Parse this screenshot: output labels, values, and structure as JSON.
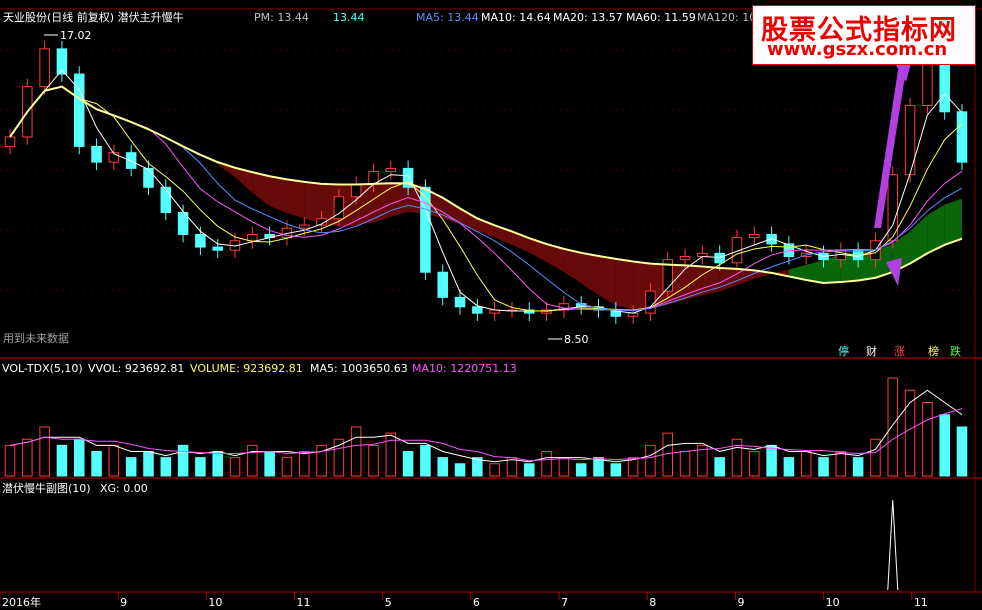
{
  "header": {
    "title": "天业股份(日线 前复权) 潜伏主升慢牛",
    "pm_label": "PM: 13.44",
    "pm_value": "13.44",
    "ma5": "MA5: 13.44",
    "ma10": "MA10: 14.64",
    "ma20": "MA20: 13.57",
    "ma60": "MA60: 11.59",
    "ma120": "MA120: 10"
  },
  "watermark": {
    "line1": "股票公式指标网",
    "line2": "www.gszx.com.cn"
  },
  "main_panel": {
    "high_label": "17.02",
    "low_label": "8.50",
    "future_note": "用到未来数据",
    "buttons": [
      "停",
      "财",
      "涨",
      "榜",
      "跌"
    ]
  },
  "vol_panel": {
    "name": "VOL-TDX(5,10)",
    "vvol": "VVOL: 923692.81",
    "volume": "VOLUME: 923692.81",
    "ma5": "MA5: 1003650.63",
    "ma10": "MA10: 1220751.13"
  },
  "sub_panel": {
    "name": "潜伏慢牛副图(10)",
    "xg": "XG: 0.00"
  },
  "x_axis": [
    "2016年",
    "9",
    "10",
    "11",
    "5",
    "6",
    "7",
    "8",
    "9",
    "10",
    "11"
  ],
  "colors": {
    "up": "#ff3c3c",
    "down": "#54ffff",
    "ma5": "#ffffff",
    "ma10": "#ffff54",
    "ma20": "#ff54ff",
    "ma60": "#5a8cff",
    "ma120": "#ffff9c",
    "band_up": "#0b6b0b",
    "band_down": "#6b0b0b",
    "grid": "#800000"
  },
  "chart_data": {
    "type": "candlestick",
    "close_series": [
      14.2,
      15.8,
      17.0,
      16.2,
      13.9,
      13.4,
      13.7,
      13.2,
      12.6,
      11.8,
      11.1,
      10.7,
      10.6,
      10.9,
      11.1,
      11.0,
      11.3,
      11.4,
      11.6,
      12.3,
      12.7,
      13.1,
      13.2,
      12.6,
      9.9,
      9.1,
      8.8,
      8.6,
      8.7,
      8.7,
      8.6,
      8.7,
      8.9,
      8.8,
      8.7,
      8.5,
      8.6,
      9.3,
      10.3,
      10.4,
      10.5,
      10.2,
      11.0,
      11.1,
      10.8,
      10.4,
      10.5,
      10.3,
      10.6,
      10.3,
      10.9,
      13.0,
      15.2,
      16.5,
      15.0,
      13.4
    ],
    "volume_series": [
      5,
      6,
      8,
      5,
      6,
      4,
      5,
      3,
      4,
      3,
      5,
      3,
      4,
      3,
      5,
      4,
      3,
      4,
      5,
      6,
      8,
      5,
      7,
      4,
      5,
      3,
      2,
      3,
      2,
      3,
      2,
      4,
      3,
      2,
      3,
      2,
      3,
      5,
      7,
      4,
      5,
      3,
      6,
      4,
      5,
      3,
      4,
      3,
      4,
      3,
      6,
      16,
      14,
      12,
      10,
      8
    ],
    "xg_signal_index": 51,
    "y_range": [
      8.0,
      17.6
    ],
    "annotations": [
      "17.02",
      "8.50"
    ]
  }
}
